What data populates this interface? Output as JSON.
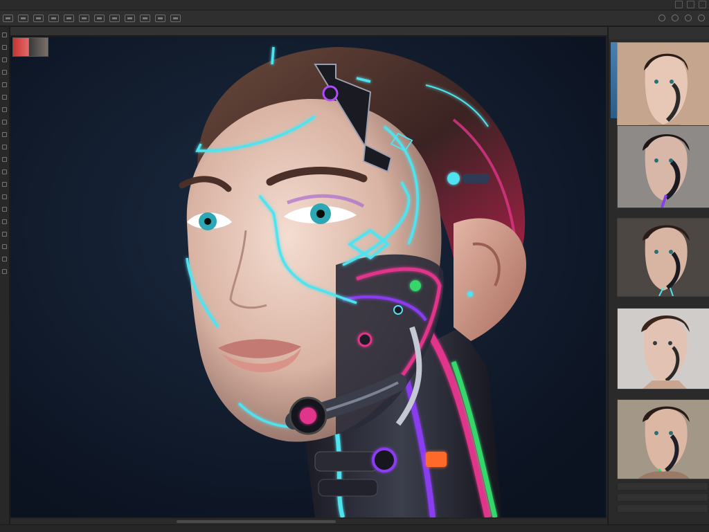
{
  "menubar": {
    "items": [
      "",
      "",
      "",
      "",
      "",
      "",
      "",
      "",
      "",
      ""
    ]
  },
  "toolbar": {
    "buttons": [
      "tool-preset",
      "new",
      "open",
      "save",
      "crop",
      "move",
      "transform",
      "brush",
      "eraser",
      "zoom",
      "hand",
      "rotate"
    ]
  },
  "document": {
    "tab_title": ""
  },
  "canvas": {
    "background": "#0f1a2b",
    "accent_cyan": "#4fe3f0",
    "accent_magenta": "#e0348a",
    "accent_purple": "#8a3cf0"
  },
  "panel": {
    "title": "",
    "thumbnails": [
      {
        "caption": "",
        "tone": "#b79a82",
        "selected": true
      },
      {
        "caption": "",
        "tone": "#8e8a87",
        "selected": false
      },
      {
        "caption": "",
        "tone": "#5a5550",
        "selected": false
      },
      {
        "caption": "",
        "tone": "#c9c6c4",
        "selected": false
      },
      {
        "caption": "",
        "tone": "#a39788",
        "selected": false
      }
    ],
    "layer_rows": [
      "",
      "",
      ""
    ]
  },
  "icons": {
    "window_controls": [
      "minimize-icon",
      "maximize-icon",
      "close-icon"
    ],
    "toolbar_right": [
      "settings-icon",
      "search-icon",
      "share-icon",
      "user-icon"
    ]
  }
}
